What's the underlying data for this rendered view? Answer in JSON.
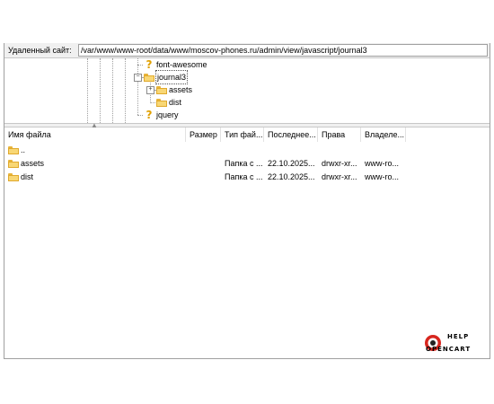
{
  "remote_site": {
    "label": "Удаленный сайт:",
    "path": "/var/www/www-root/data/www/moscov-phones.ru/admin/view/javascript/journal3"
  },
  "tree": {
    "items": [
      {
        "label": "font-awesome",
        "icon": "question-icon"
      },
      {
        "label": "journal3",
        "icon": "folder-icon",
        "expander": "−",
        "selected": true
      },
      {
        "label": "assets",
        "icon": "folder-icon",
        "expander": "+"
      },
      {
        "label": "dist",
        "icon": "folder-icon"
      },
      {
        "label": "jquery",
        "icon": "question-icon"
      }
    ]
  },
  "columns": [
    "Имя файла",
    "Размер",
    "Тип фай...",
    "Последнее...",
    "Права",
    "Владеле..."
  ],
  "files": [
    {
      "name": "..",
      "size": "",
      "type": "",
      "modified": "",
      "perms": "",
      "owner": ""
    },
    {
      "name": "assets",
      "size": "",
      "type": "Папка с ...",
      "modified": "22.10.2025...",
      "perms": "drwxr-xr...",
      "owner": "www-ro..."
    },
    {
      "name": "dist",
      "size": "",
      "type": "Папка с ...",
      "modified": "22.10.2025...",
      "perms": "drwxr-xr...",
      "owner": "www-ro..."
    }
  ],
  "watermark": {
    "line1": "HELP",
    "line2": "OPENCART",
    "accent": "#d7261e"
  }
}
